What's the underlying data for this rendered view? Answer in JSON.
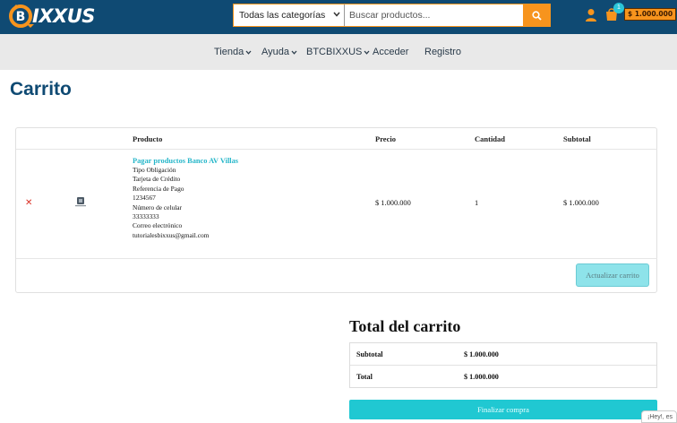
{
  "brand": {
    "logo_text": "IXXUS"
  },
  "search": {
    "category_selected": "Todas las categorías",
    "placeholder": "Buscar productos..."
  },
  "header": {
    "cart_count": "1",
    "cart_total": "$ 1.000.000"
  },
  "nav": {
    "items": [
      {
        "label": "Tienda",
        "has_dropdown": true
      },
      {
        "label": "Ayuda",
        "has_dropdown": true
      },
      {
        "label": "BTCBIXXUS",
        "has_dropdown": true
      },
      {
        "label": "Acceder",
        "has_dropdown": false
      },
      {
        "label": "Registro",
        "has_dropdown": false
      }
    ]
  },
  "page": {
    "title": "Carrito"
  },
  "cart": {
    "columns": [
      "Producto",
      "Precio",
      "Cantidad",
      "Subtotal"
    ],
    "item": {
      "name": "Pagar productos Banco AV Villas",
      "details": [
        "Tipo Obligación",
        "Tarjeta de Crédito",
        "Referencia de Pago",
        "1234567",
        "Número de celular",
        "33333333",
        "Correo electrónico",
        "tutorialesbixxus@gmail.com"
      ],
      "price": "$ 1.000.000",
      "quantity": "1",
      "subtotal": "$ 1.000.000"
    },
    "update_label": "Actualizar carrito"
  },
  "totals": {
    "title": "Total del carrito",
    "subtotal_label": "Subtotal",
    "subtotal_value": "$ 1.000.000",
    "total_label": "Total",
    "total_value": "$ 1.000.000",
    "checkout_label": "Finalizar compra"
  },
  "chat": {
    "label": "¡Hey!, es"
  },
  "colors": {
    "header": "#0f4a73",
    "accent": "#f7941d",
    "teal": "#20c8d2"
  }
}
